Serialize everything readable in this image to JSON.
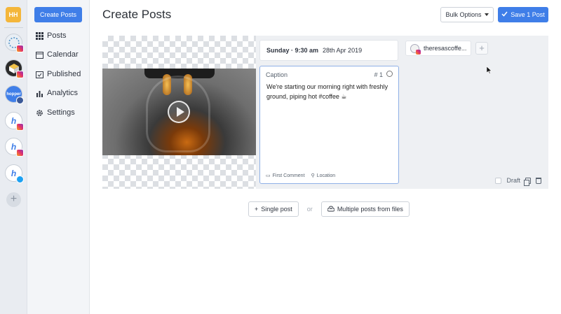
{
  "rail": {
    "workspace_initials": "HH",
    "accounts": [
      {
        "name": "account-1",
        "network": "instagram",
        "letter": "",
        "bg": "#e8eef4"
      },
      {
        "name": "account-2",
        "network": "instagram",
        "letter": "",
        "bg": "#2b2b2b"
      },
      {
        "name": "account-3",
        "network": "facebook",
        "letter": "hopper",
        "bg": "#3f7ee8"
      },
      {
        "name": "account-4",
        "network": "instagram",
        "letter": "h",
        "bg": "#ffffff"
      },
      {
        "name": "account-5",
        "network": "instagram",
        "letter": "h",
        "bg": "#ffffff"
      },
      {
        "name": "account-6",
        "network": "twitter",
        "letter": "h",
        "bg": "#ffffff"
      }
    ],
    "add_symbol": "+"
  },
  "nav": {
    "create_label": "Create Posts",
    "items": [
      {
        "label": "Posts",
        "icon": "grid-icon"
      },
      {
        "label": "Calendar",
        "icon": "calendar-icon"
      },
      {
        "label": "Published",
        "icon": "check-calendar-icon"
      },
      {
        "label": "Analytics",
        "icon": "bar-chart-icon"
      },
      {
        "label": "Settings",
        "icon": "gear-icon"
      }
    ]
  },
  "header": {
    "title": "Create Posts",
    "bulk_label": "Bulk Options",
    "save_label": "Save 1 Post"
  },
  "post": {
    "day_time": "Sunday · 9:30 am",
    "date": "28th Apr 2019",
    "caption_label": "Caption",
    "caption_number": "# 1",
    "caption_text": "We're starting our morning right with freshly ground, piping hot #coffee ☕",
    "first_comment": "First Comment",
    "location": "Location",
    "account_name": "theresascoffe...",
    "add_account": "+",
    "draft_label": "Draft"
  },
  "add": {
    "single_label": "Single post",
    "or_label": "or",
    "multiple_label": "Multiple posts from files"
  },
  "colors": {
    "accent": "#3f7ee8",
    "workspace": "#f4b63a"
  }
}
